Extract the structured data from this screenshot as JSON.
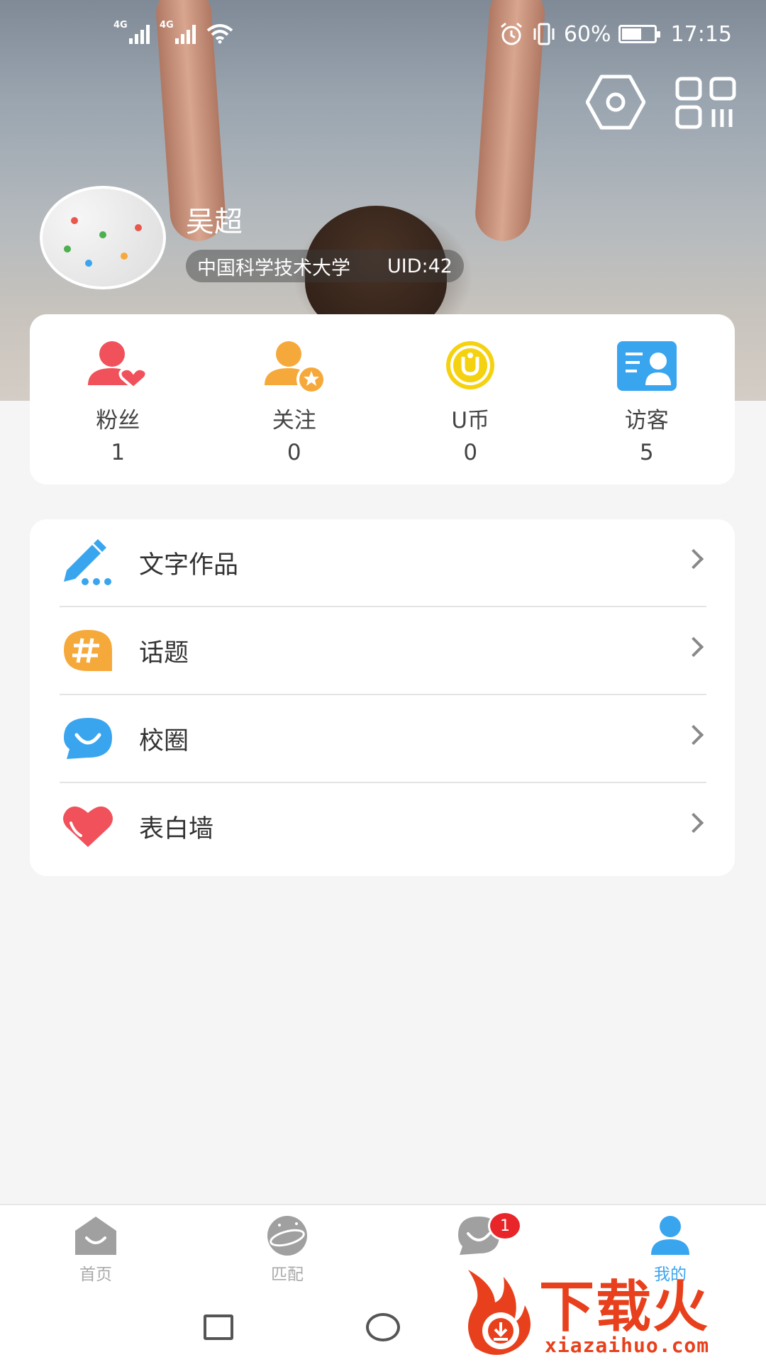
{
  "status_bar": {
    "network_1": "4G",
    "network_2": "4G",
    "battery": "60%",
    "time": "17:15"
  },
  "header": {
    "settings_icon": "hexagon-settings-icon",
    "qr_icon": "qr-scan-icon"
  },
  "profile": {
    "name": "吴超",
    "school": "中国科学技术大学",
    "uid": "UID:42"
  },
  "stats": [
    {
      "label": "粉丝",
      "count": "1",
      "icon": "fans-heart-icon",
      "color": "#f0515a"
    },
    {
      "label": "关注",
      "count": "0",
      "icon": "follow-star-icon",
      "color": "#f6a93b"
    },
    {
      "label": "U币",
      "count": "0",
      "icon": "u-coin-icon",
      "color": "#f5d210"
    },
    {
      "label": "访客",
      "count": "5",
      "icon": "visitor-card-icon",
      "color": "#3aa5ef"
    }
  ],
  "menu": [
    {
      "label": "文字作品",
      "icon": "pencil-icon",
      "color": "#3aa5ef"
    },
    {
      "label": "话题",
      "icon": "hashtag-icon",
      "color": "#f6a93b"
    },
    {
      "label": "校圈",
      "icon": "smile-bubble-icon",
      "color": "#3aa5ef"
    },
    {
      "label": "表白墙",
      "icon": "heart-icon",
      "color": "#f0515a"
    }
  ],
  "tabs": [
    {
      "label": "首页",
      "icon": "home-icon"
    },
    {
      "label": "匹配",
      "icon": "planet-icon"
    },
    {
      "label": "",
      "icon": "chat-icon",
      "badge": "1"
    },
    {
      "label": "我的",
      "icon": "profile-icon"
    }
  ],
  "watermark": {
    "text": "下载火",
    "url": "xiazaihuo.com"
  }
}
